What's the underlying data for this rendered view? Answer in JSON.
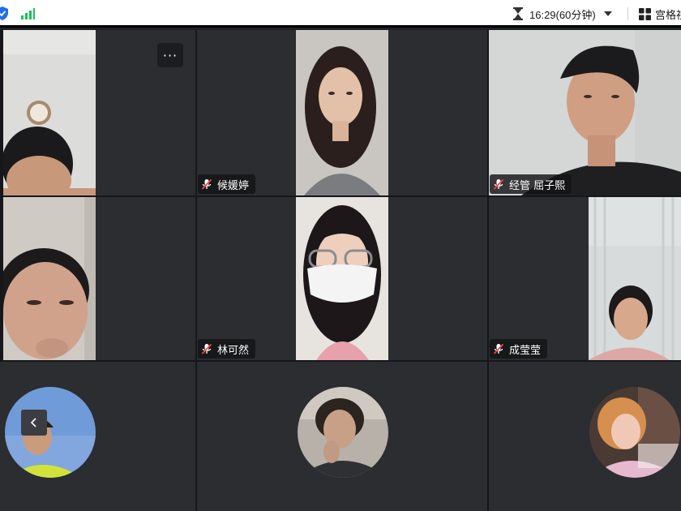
{
  "toolbar": {
    "timer_text": "16:29(60分钟)",
    "gallery_label": "宫格视图"
  },
  "participants": {
    "p1": {
      "more_label": "···"
    },
    "p2": {
      "name": "候媛婷"
    },
    "p3": {
      "name": "经管 屈子熙"
    },
    "p5": {
      "name": "林可然"
    },
    "p6": {
      "name": "成莹莹"
    }
  },
  "icons": {
    "security": "shield-check-icon",
    "network": "signal-bars-icon",
    "timer": "hourglass-icon",
    "dropdown": "chevron-down-icon",
    "view": "grid-view-icon",
    "mic": "mic-muted-icon",
    "prev": "chevron-left-icon"
  },
  "colors": {
    "shield": "#1e6ff0",
    "signal": "#19c05a",
    "tile": "#2b2d31",
    "mic_muted": "#f04848"
  }
}
